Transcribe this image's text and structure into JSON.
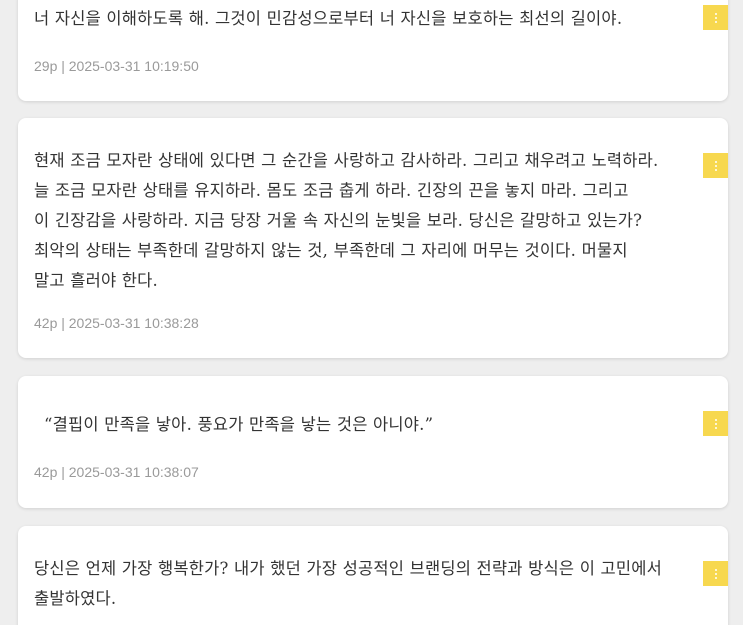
{
  "colors": {
    "background": "#eeeeee",
    "card": "#ffffff",
    "accent": "#f7d84f",
    "text": "#333333",
    "meta": "#9a9a9a"
  },
  "notes": [
    {
      "text": "너 자신을 이해하도록 해. 그것이 민감성으로부터 너 자신을 보호하는 최선의 길이야.",
      "meta": "29p | 2025-03-31 10:19:50",
      "menu_icon": "kebab-vertical-icon"
    },
    {
      "text": "현재 조금 모자란 상태에 있다면 그 순간을 사랑하고 감사하라. 그리고 채우려고 노력하라.\n늘 조금 모자란 상태를 유지하라. 몸도 조금 춥게 하라. 긴장의 끈을 놓지 마라. 그리고\n이 긴장감을 사랑하라. 지금 당장 거울 속 자신의 눈빛을 보라. 당신은 갈망하고 있는가?\n최악의 상태는 부족한데 갈망하지 않는 것, 부족한데 그 자리에 머무는 것이다. 머물지\n말고 흘러야 한다.",
      "meta": "42p | 2025-03-31 10:38:28",
      "menu_icon": "kebab-vertical-icon"
    },
    {
      "text": "“결핍이 만족을 낳아. 풍요가 만족을 낳는 것은 아니야.”",
      "meta": "42p | 2025-03-31 10:38:07",
      "menu_icon": "kebab-vertical-icon"
    },
    {
      "text": "당신은 언제 가장 행복한가? 내가 했던 가장 성공적인 브랜딩의 전략과 방식은 이 고민에서\n출발하였다.",
      "meta": "",
      "menu_icon": "kebab-vertical-icon"
    }
  ]
}
